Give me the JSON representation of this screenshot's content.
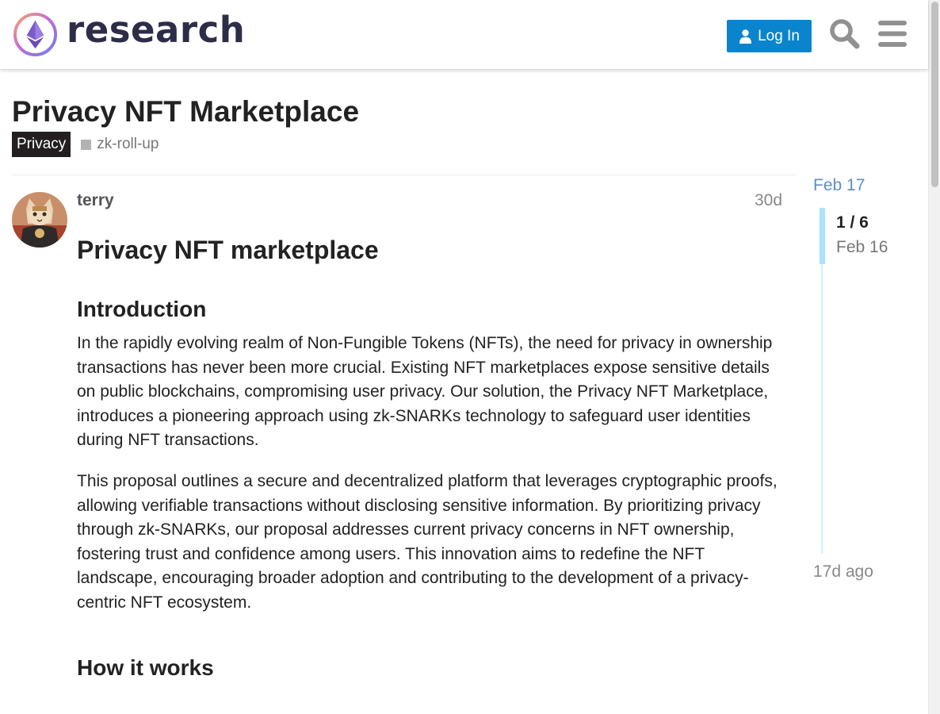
{
  "header": {
    "logo_text": "research",
    "login_label": "Log In",
    "accent": "#0a84cc"
  },
  "topic": {
    "title": "Privacy NFT Marketplace",
    "category": "Privacy",
    "category_color": "#231f20",
    "tag": "zk-roll-up"
  },
  "post": {
    "username": "terry",
    "date": "30d",
    "heading": "Privacy NFT marketplace",
    "section1_title": "Introduction",
    "paragraph1": "In the rapidly evolving realm of Non-Fungible Tokens (NFTs), the need for privacy in ownership transactions has never been more crucial. Existing NFT marketplaces expose sensitive details on public blockchains, compromising user privacy. Our solution, the Privacy NFT Marketplace, introduces a pioneering approach using zk-SNARKs technology to safeguard user identities during NFT transactions.",
    "paragraph2": "This proposal outlines a secure and decentralized platform that leverages cryptographic proofs, allowing verifiable transactions without disclosing sensitive information. By prioritizing privacy through zk-SNARKs, our proposal addresses current privacy concerns in NFT ownership, fostering trust and confidence among users. This innovation aims to redefine the NFT landscape, encouraging broader adoption and contributing to the development of a privacy-centric NFT ecosystem.",
    "section2_title": "How it works"
  },
  "timeline": {
    "start_date": "Feb 17",
    "position": "1 / 6",
    "handle_date": "Feb 16",
    "end_label": "17d ago",
    "progress_fraction": 0.167
  },
  "icons": {
    "logo": "ethereum-research-logo-icon",
    "user": "user-icon",
    "search": "search-icon",
    "menu": "hamburger-menu-icon"
  }
}
